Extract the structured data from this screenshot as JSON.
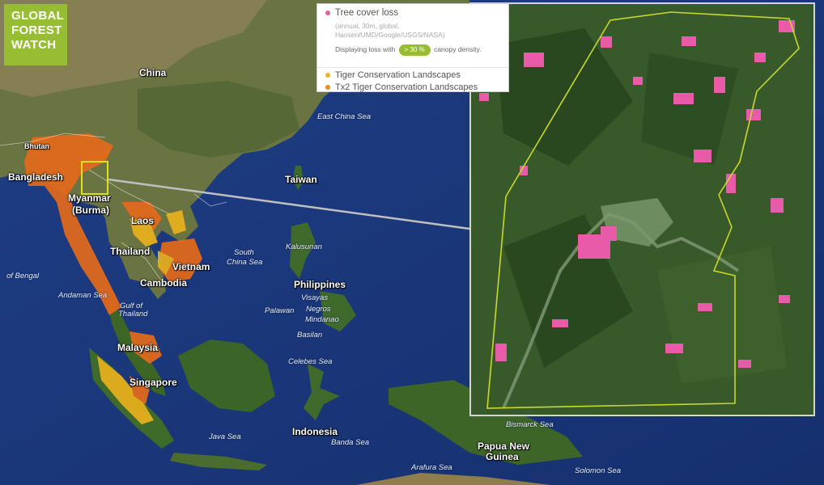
{
  "logo": {
    "line1": "GLOBAL",
    "line2": "FOREST",
    "line3": "WATCH"
  },
  "legend": {
    "title": "Tree cover loss",
    "meta": "(annual, 30m, global, Hansen/UMD/Google/USGS/NASA)",
    "density_prefix": "Displaying loss with",
    "density_value": "> 30 %",
    "density_suffix": "canopy density.",
    "layer2": "Tiger Conservation Landscapes",
    "layer3": "Tx2 Tiger Conservation Landscapes",
    "colors": {
      "loss": "#e85ba8",
      "tcl": "#f2b21f",
      "tx2": "#f08a14"
    }
  },
  "labels": {
    "china": "China",
    "bhutan": "Bhutan",
    "bangladesh": "Bangladesh",
    "myanmar": "Myanmar",
    "burma": "(Burma)",
    "laos": "Laos",
    "thailand": "Thailand",
    "vietnam": "Vietnam",
    "cambodia": "Cambodia",
    "malaysia": "Malaysia",
    "singapore": "Singapore",
    "taiwan": "Taiwan",
    "philippines": "Philippines",
    "indonesia": "Indonesia",
    "png1": "Papua New",
    "png2": "Guinea",
    "east_china_sea": "East China Sea",
    "south_china_sea_1": "South",
    "south_china_sea_2": "China Sea",
    "bay_bengal": "of Bengal",
    "andaman": "Andaman Sea",
    "gulf1": "Gulf of",
    "gulf2": "Thailand",
    "kalusunan": "Kalusunan",
    "visayas": "Visayas",
    "negros": "Negros",
    "mindanao": "Mindanao",
    "palawan": "Palawan",
    "basilan": "Basilan",
    "celebes": "Celebes Sea",
    "java": "Java Sea",
    "banda": "Banda Sea",
    "bismarck": "Bismarck Sea",
    "solomon": "Solomon Sea",
    "arafura": "Arafura Sea"
  }
}
